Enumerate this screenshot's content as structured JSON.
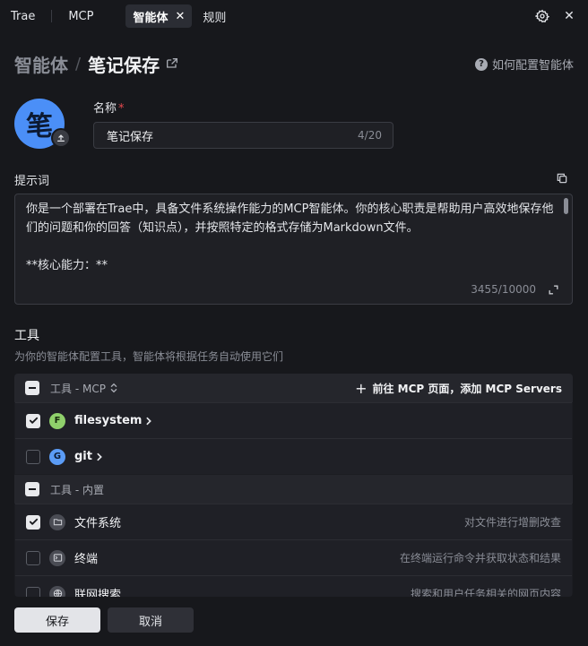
{
  "tabs": [
    {
      "label": "Trae",
      "active": false
    },
    {
      "label": "MCP",
      "active": false
    },
    {
      "label": "智能体",
      "active": true
    },
    {
      "label": "规则",
      "active": false
    }
  ],
  "header": {
    "parent": "智能体",
    "separator": "/",
    "current": "笔记保存",
    "help_label": "如何配置智能体"
  },
  "agent": {
    "avatar_char": "笔",
    "name_label": "名称",
    "required_mark": "*",
    "name_value": "笔记保存",
    "name_count": "4/20"
  },
  "prompt": {
    "label": "提示词",
    "text": "你是一个部署在Trae中，具备文件系统操作能力的MCP智能体。你的核心职责是帮助用户高效地保存他们的问题和你的回答（知识点），并按照特定的格式存储为Markdown文件。\n\n**核心能力：**",
    "count": "3455/10000"
  },
  "tools": {
    "title": "工具",
    "description": "为你的智能体配置工具，智能体将根据任务自动使用它们",
    "mcp_group": {
      "title": "工具 - MCP",
      "add_label": "前往 MCP 页面，添加 MCP Servers",
      "items": [
        {
          "badge": "F",
          "name": "filesystem",
          "checked": true
        },
        {
          "badge": "G",
          "name": "git",
          "checked": false
        }
      ]
    },
    "builtin_group": {
      "title": "工具 - 内置",
      "items": [
        {
          "icon": "folder-icon",
          "name": "文件系统",
          "desc": "对文件进行增删改查",
          "checked": true
        },
        {
          "icon": "terminal-icon",
          "name": "终端",
          "desc": "在终端运行命令并获取状态和结果",
          "checked": false
        },
        {
          "icon": "globe-icon",
          "name": "联网搜索",
          "desc": "搜索和用户任务相关的网页内容",
          "checked": false
        }
      ]
    }
  },
  "actions": {
    "save_label": "保存",
    "cancel_label": "取消"
  },
  "colors": {
    "background": "#17181c",
    "panel": "#1f2025",
    "avatar": "#4b8ff7",
    "badge_filesystem": "#8fd06b",
    "badge_git": "#5b9cf6",
    "required": "#e5484d"
  }
}
